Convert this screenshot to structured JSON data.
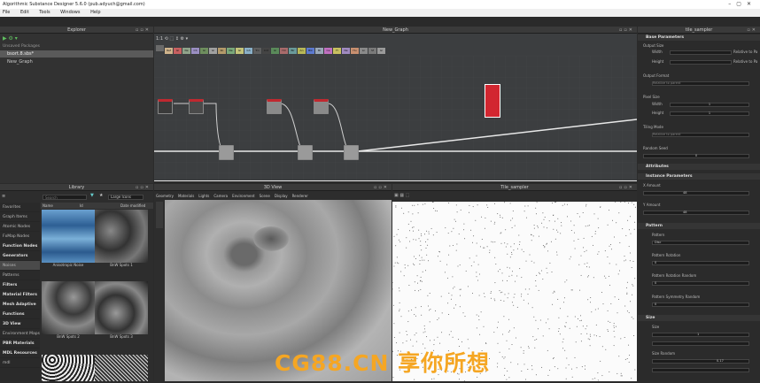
{
  "window": {
    "title": "Algorithmic Substance Designer 5.6.0 (pub.adyuch@gmail.com)"
  },
  "menu": [
    "File",
    "Edit",
    "Tools",
    "Windows",
    "Help"
  ],
  "explorer": {
    "title": "Explorer",
    "root": "Unsaved Packages",
    "package": "bsort.8.sbs*",
    "graph": "New_Graph"
  },
  "graph": {
    "title": "New_Graph",
    "zoom": "1:1",
    "swatches": [
      {
        "label": "",
        "color": "#6a6a6a"
      },
      {
        "label": "Ref",
        "color": "#d0b48c"
      },
      {
        "label": "Gl",
        "color": "#c76060"
      },
      {
        "label": "Ne",
        "color": "#8fa38a"
      },
      {
        "label": "CS",
        "color": "#9a8fc2"
      },
      {
        "label": "Gl",
        "color": "#6e8e5e"
      },
      {
        "label": "Gl",
        "color": "#a0a0a0"
      },
      {
        "label": "Ro",
        "color": "#b49a6a"
      },
      {
        "label": "Ne",
        "color": "#7aa87a"
      },
      {
        "label": "Gl",
        "color": "#c4c47a"
      },
      {
        "label": "Gh",
        "color": "#8ab0c8"
      },
      {
        "label": "Trn",
        "color": "#5e5e5e"
      },
      {
        "label": "Crd",
        "color": "#444444"
      },
      {
        "label": "Gl",
        "color": "#5a8a5a"
      },
      {
        "label": "Hd",
        "color": "#a86b6b"
      },
      {
        "label": "Blr",
        "color": "#6a9a9a"
      },
      {
        "label": "An",
        "color": "#b8b858"
      },
      {
        "label": "Blk",
        "color": "#5c7ad0"
      },
      {
        "label": "Bl",
        "color": "#9aa8b8"
      },
      {
        "label": "Ca",
        "color": "#c070c0"
      },
      {
        "label": "Fl",
        "color": "#c8c060"
      },
      {
        "label": "Ne",
        "color": "#a08ac0"
      },
      {
        "label": "Hu",
        "color": "#c89070"
      },
      {
        "label": "Ln",
        "color": "#8a8a8a"
      },
      {
        "label": "Sf",
        "color": "#7a7a7a"
      },
      {
        "label": "Gl",
        "color": "#9a9a9a"
      }
    ]
  },
  "library": {
    "title": "Library",
    "search_placeholder": "Search",
    "filter": "Large Icons",
    "columns": [
      "Name",
      "Id",
      "Date modified"
    ],
    "categories": [
      "Favorites",
      "Graph Items",
      "Atomic Nodes",
      "FxMap Nodes",
      "Function Nodes",
      "Generators",
      "Noises",
      "Patterns",
      "Filters",
      "Material Filters",
      "Mesh Adaptive",
      "Functions",
      "3D View",
      "Environment Maps",
      "PBR Materials",
      "MDL Resources",
      "mdl"
    ],
    "thumbs": [
      "Anisotropic Noise",
      "BnW Spots 1",
      "BnW Spots 2",
      "BnW Spots 3",
      "",
      ""
    ]
  },
  "view3d": {
    "title": "3D View",
    "menu": [
      "Geometry",
      "Materials",
      "Lights",
      "Camera",
      "Environment",
      "Scene",
      "Display",
      "Renderer"
    ]
  },
  "tile": {
    "title": "Tile_sampler"
  },
  "params": {
    "title": "tile_sampler",
    "sections": {
      "base": "Base Parameters",
      "attributes": "Attributes",
      "instance": "Instance Parameters",
      "pattern": "Pattern",
      "size": "Size"
    },
    "output_size": {
      "label": "Output Size",
      "width_label": "Width",
      "height_label": "Height",
      "width_val": "1",
      "height_val": "1",
      "rel_w": "Relative to Pa",
      "rel_h": "Relative to Pa"
    },
    "output_format": {
      "label": "Output Format",
      "value": "Relative to parent"
    },
    "pixel_size": {
      "label": "Pixel Size",
      "width_label": "Width",
      "height_label": "Height",
      "width_val": "1",
      "height_val": "1"
    },
    "tiling": {
      "label": "Tiling Mode",
      "value": "Relative to parent"
    },
    "seed": {
      "label": "Random Seed",
      "value": "0"
    },
    "x_amount": {
      "label": "X Amount",
      "value": "48"
    },
    "y_amount": {
      "label": "Y Amount",
      "value": "48"
    },
    "pattern": {
      "label": "Pattern",
      "value": "Disc"
    },
    "pattern_rotation": {
      "label": "Pattern Rotation",
      "value": "0"
    },
    "pattern_rot_random": {
      "label": "Pattern Rotation Random",
      "value": "0"
    },
    "pattern_variation": {
      "label": "Pattern Symmetry Random",
      "value": "0"
    },
    "size_label": "Size",
    "size_val": "1",
    "size_random": {
      "label": "Size Random",
      "value": "0.17"
    }
  },
  "watermark": "CG88.CN 享你所想"
}
